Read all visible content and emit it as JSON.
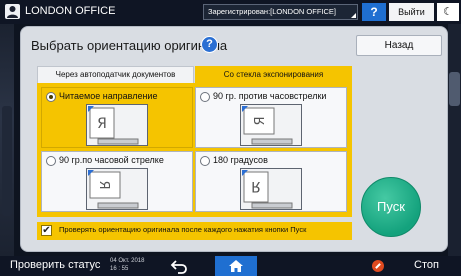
{
  "header": {
    "office_name": "LONDON OFFICE",
    "login_status": "Зарегистрирован:[LONDON OFFICE]",
    "help_label": "?",
    "logout_label": "Выйти",
    "energy_label": "☾"
  },
  "dialog": {
    "title": "Выбрать ориентацию оригинала",
    "help_label": "?",
    "back_label": "Назад",
    "tabs": [
      {
        "label": "Через автоподатчик документов",
        "selected": false
      },
      {
        "label": "Со стекла экспонирования",
        "selected": true
      }
    ],
    "options": [
      {
        "label": "Читаемое направление",
        "selected": true
      },
      {
        "label": "90 гр. против часовстрелки",
        "selected": false
      },
      {
        "label": "90 гр.по часовой стрелке",
        "selected": false
      },
      {
        "label": "180 градусов",
        "selected": false
      }
    ],
    "checkbox": {
      "label": "Проверять ориентацию оригинала после каждого нажатия кнопки Пуск",
      "checked": true,
      "mark": "✔"
    },
    "start_label": "Пуск"
  },
  "footer": {
    "check_status_label": "Проверить статус",
    "date": "04 Окт. 2018",
    "time": "16 : 55",
    "stop_label": "Стоп"
  },
  "colors": {
    "selected_yellow": "#f5c400",
    "start_green": "#1fae86",
    "accent_blue": "#1f6fd1",
    "stop_red": "#e04a1f"
  }
}
